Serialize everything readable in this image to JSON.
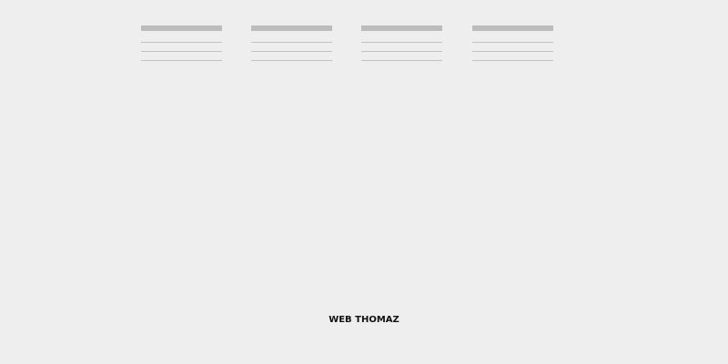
{
  "colors": {
    "background": "#eeeeee",
    "heading_bar": "#bcbcbc",
    "placeholder_line": "#c1c1c1",
    "footer_text": "#111111"
  },
  "footer": {
    "brand": "WEB THOMAZ"
  }
}
